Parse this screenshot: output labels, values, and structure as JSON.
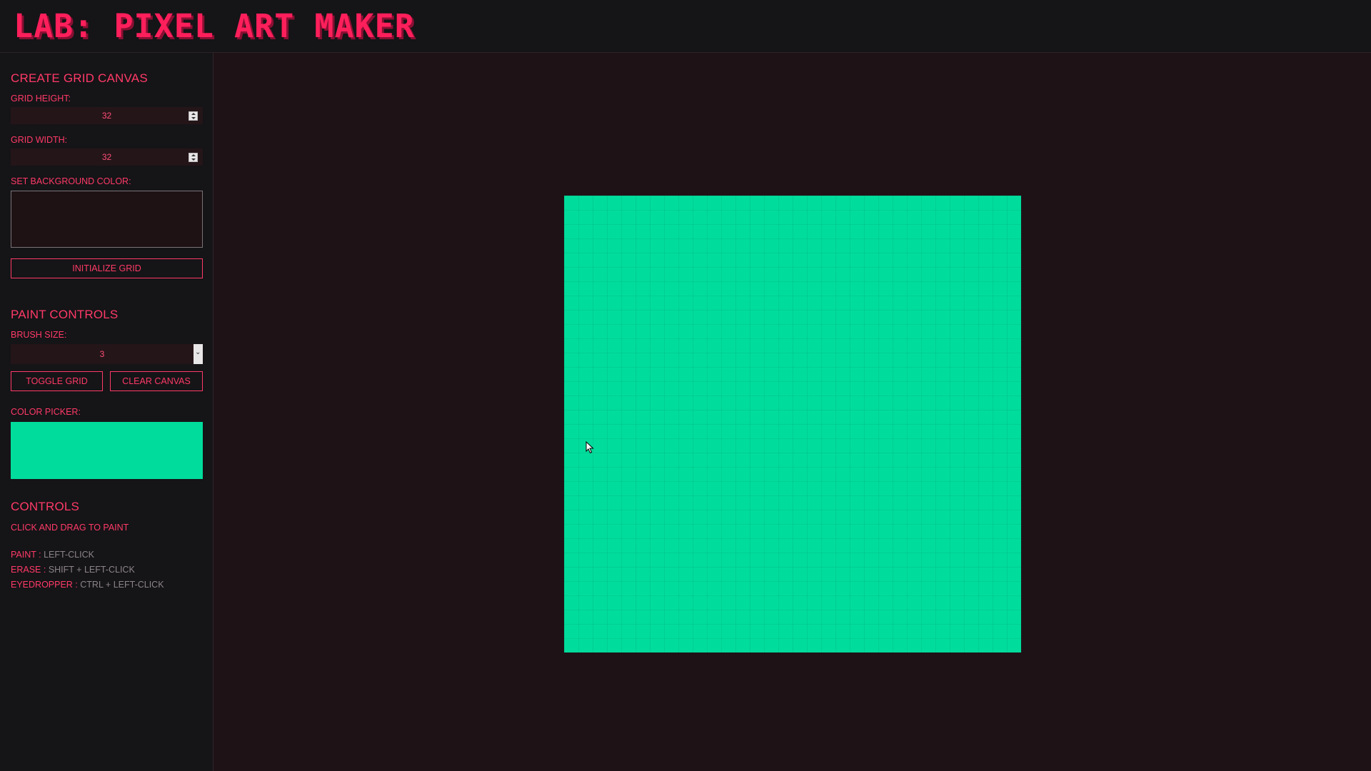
{
  "header": {
    "title": "LAB: PIXEL ART MAKER"
  },
  "sidebar": {
    "create_grid": {
      "title": "CREATE GRID CANVAS",
      "grid_height_label": "GRID HEIGHT:",
      "grid_height_value": "32",
      "grid_width_label": "GRID WIDTH:",
      "grid_width_value": "32",
      "bg_color_label": "SET BACKGROUND COLOR:",
      "initialize_button": "INITIALIZE GRID"
    },
    "paint_controls": {
      "title": "PAINT CONTROLS",
      "brush_size_label": "BRUSH SIZE:",
      "brush_size_value": "3",
      "toggle_grid_button": "TOGGLE GRID",
      "clear_canvas_button": "CLEAR CANVAS",
      "color_picker_label": "COLOR PICKER:",
      "selected_color": "#00dc9c"
    },
    "controls": {
      "title": "CONTROLS",
      "hint": "CLICK AND DRAG TO PAINT",
      "items": [
        {
          "key": "PAINT :",
          "value": "LEFT-CLICK"
        },
        {
          "key": "ERASE :",
          "value": "SHIFT + LEFT-CLICK"
        },
        {
          "key": "EYEDROPPER :",
          "value": "CTRL + LEFT-CLICK"
        }
      ]
    }
  },
  "canvas": {
    "rows": 32,
    "columns": 32,
    "fill_color": "#00dc9c",
    "grid_visible": true
  },
  "colors": {
    "accent": "#ff3a67",
    "title": "#ff1f5b",
    "panel_bg": "#151417",
    "main_bg": "#1f1216"
  },
  "icons": {
    "cursor": "arrow-cursor-icon",
    "spinner": "number-spinner-icon",
    "dropdown": "chevron-down-icon"
  }
}
